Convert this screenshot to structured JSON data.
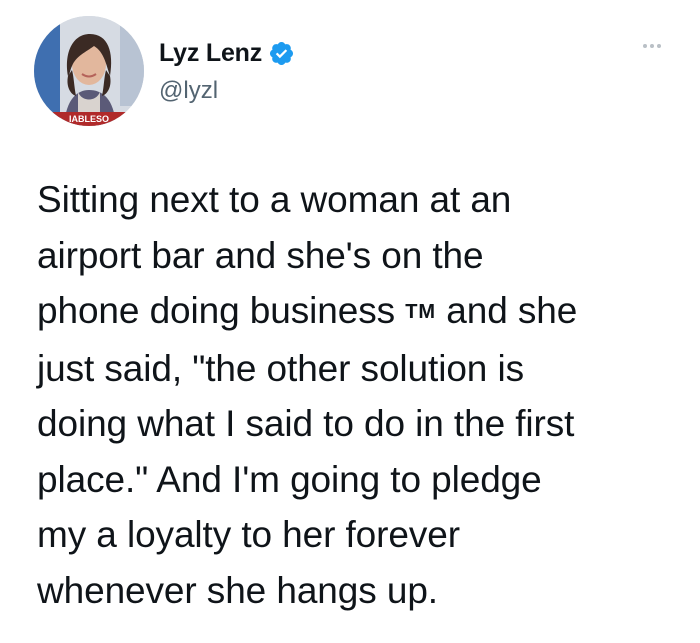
{
  "tweet": {
    "author": {
      "display_name": "Lyz Lenz",
      "handle": "@lyzl",
      "verified": true,
      "avatar_banner_text": "IABLESO",
      "verified_color": "#1d9bf0"
    },
    "more_icon": "more-horizontal-icon",
    "text_lines": [
      "Sitting next to a woman at an",
      "airport bar and she's on the",
      "phone doing business",
      "and she",
      "just said, \"the other solution is",
      "doing what I said to do in the first",
      "place.\" And I'm going to pledge",
      "my a loyalty to her forever",
      "whenever she hangs up."
    ],
    "trademark_symbol": "TM"
  }
}
